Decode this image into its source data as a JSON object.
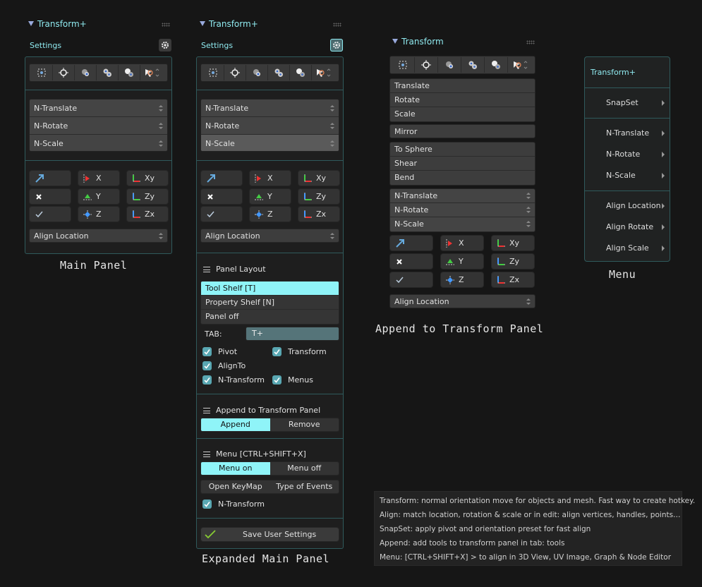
{
  "main_panel": {
    "title": "Transform+",
    "settings_label": "Settings",
    "transform_items": [
      "N-Translate",
      "N-Rotate",
      "N-Scale"
    ],
    "axis_buttons": [
      [
        "",
        "X",
        "Xy"
      ],
      [
        "",
        "Y",
        "Zy"
      ],
      [
        "",
        "Z",
        "Zx"
      ]
    ],
    "align_location": "Align Location",
    "caption": "Main Panel"
  },
  "expanded_panel": {
    "title": "Transform+",
    "settings_label": "Settings",
    "transform_items": [
      "N-Translate",
      "N-Rotate",
      "N-Scale"
    ],
    "axis_buttons": [
      [
        "",
        "X",
        "Xy"
      ],
      [
        "",
        "Y",
        "Zy"
      ],
      [
        "",
        "Z",
        "Zx"
      ]
    ],
    "align_location": "Align Location",
    "panel_layout": {
      "header": "Panel Layout",
      "options": [
        "Tool Shelf [T]",
        "Property Shelf [N]",
        "Panel off"
      ],
      "selected": "Tool Shelf [T]",
      "tab_label": "TAB:",
      "tab_value": "T+",
      "checks": {
        "pivot": "Pivot",
        "transform": "Transform",
        "alignto": "AlignTo",
        "ntransform": "N-Transform",
        "menus": "Menus"
      }
    },
    "append_section": {
      "header": "Append to Transform Panel",
      "append": "Append",
      "remove": "Remove"
    },
    "menu_section": {
      "header": "Menu [CTRL+SHIFT+X]",
      "menu_on": "Menu on",
      "menu_off": "Menu off",
      "open_keymap": "Open KeyMap",
      "type_of_events": "Type of Events",
      "ntransform": "N-Transform"
    },
    "save_label": "Save User Settings",
    "caption": "Expanded Main Panel"
  },
  "transform_panel": {
    "title": "Transform",
    "ops_group1": [
      "Translate",
      "Rotate",
      "Scale"
    ],
    "mirror": "Mirror",
    "ops_group2": [
      "To Sphere",
      "Shear",
      "Bend"
    ],
    "transform_items": [
      "N-Translate",
      "N-Rotate",
      "N-Scale"
    ],
    "axis_buttons": [
      [
        "",
        "X",
        "Xy"
      ],
      [
        "",
        "Y",
        "Zy"
      ],
      [
        "",
        "Z",
        "Zx"
      ]
    ],
    "align_location": "Align Location",
    "caption": "Append to Transform Panel"
  },
  "menu_popup": {
    "title": "Transform+",
    "items": [
      "SnapSet",
      "N-Translate",
      "N-Rotate",
      "N-Scale",
      "Align Location",
      "Align Rotate",
      "Align Scale"
    ],
    "caption": "Menu"
  },
  "info_lines": [
    "Transform: normal orientation move for objects and mesh. Fast way to create hotkey.",
    "Align: match location, rotation & scale or in edit: align vertices, handles, points…",
    "SnapSet: apply pivot and orientation preset for fast align",
    "Append: add tools to transform panel in tab: tools",
    "Menu: [CTRL+SHIFT+X] > to align in 3D View, UV Image, Graph & Node Editor"
  ],
  "colors": {
    "accent": "#8ff4f8",
    "border": "#2f5a5c",
    "background": "#161616"
  }
}
